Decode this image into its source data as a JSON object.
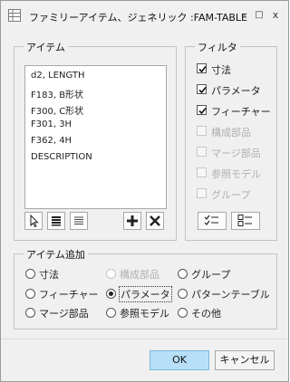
{
  "window": {
    "title": "ファミリーアイテム、ジェネリック :FAM-TABLE",
    "minimize_glyph": "–",
    "maximize_glyph": "□",
    "close_glyph": "x"
  },
  "items_panel": {
    "label": "アイテム",
    "items": [
      "d2, LENGTH",
      "F183, B形状",
      "F300, C形状",
      "F301, 3H",
      "F362, 4H",
      "DESCRIPTION"
    ],
    "tools": [
      "select-pointer-icon",
      "select-all-icon",
      "deselect-all-icon",
      "add-icon",
      "remove-icon"
    ]
  },
  "filter_panel": {
    "label": "フィルタ",
    "options": [
      {
        "label": "寸法",
        "checked": true,
        "enabled": true
      },
      {
        "label": "パラメータ",
        "checked": true,
        "enabled": true
      },
      {
        "label": "フィーチャー",
        "checked": true,
        "enabled": true
      },
      {
        "label": "構成部品",
        "checked": false,
        "enabled": false
      },
      {
        "label": "マージ部品",
        "checked": false,
        "enabled": false
      },
      {
        "label": "参照モデル",
        "checked": false,
        "enabled": false
      },
      {
        "label": "グループ",
        "checked": false,
        "enabled": false
      }
    ],
    "tools": [
      "check-all-icon",
      "uncheck-all-icon"
    ]
  },
  "add_item_panel": {
    "label": "アイテム追加",
    "options": [
      {
        "label": "寸法",
        "selected": false,
        "enabled": true
      },
      {
        "label": "構成部品",
        "selected": false,
        "enabled": false
      },
      {
        "label": "グループ",
        "selected": false,
        "enabled": true
      },
      {
        "label": "フィーチャー",
        "selected": false,
        "enabled": true
      },
      {
        "label": "パラメータ",
        "selected": true,
        "enabled": true
      },
      {
        "label": "パターンテーブル",
        "selected": false,
        "enabled": true
      },
      {
        "label": "マージ部品",
        "selected": false,
        "enabled": true
      },
      {
        "label": "参照モデル",
        "selected": false,
        "enabled": true
      },
      {
        "label": "その他",
        "selected": false,
        "enabled": true
      }
    ]
  },
  "footer": {
    "ok_label": "OK",
    "cancel_label": "キャンセル"
  },
  "colors": {
    "ok_button_bg": "#b7e0f8",
    "dialog_bg": "#f0f0f0"
  }
}
